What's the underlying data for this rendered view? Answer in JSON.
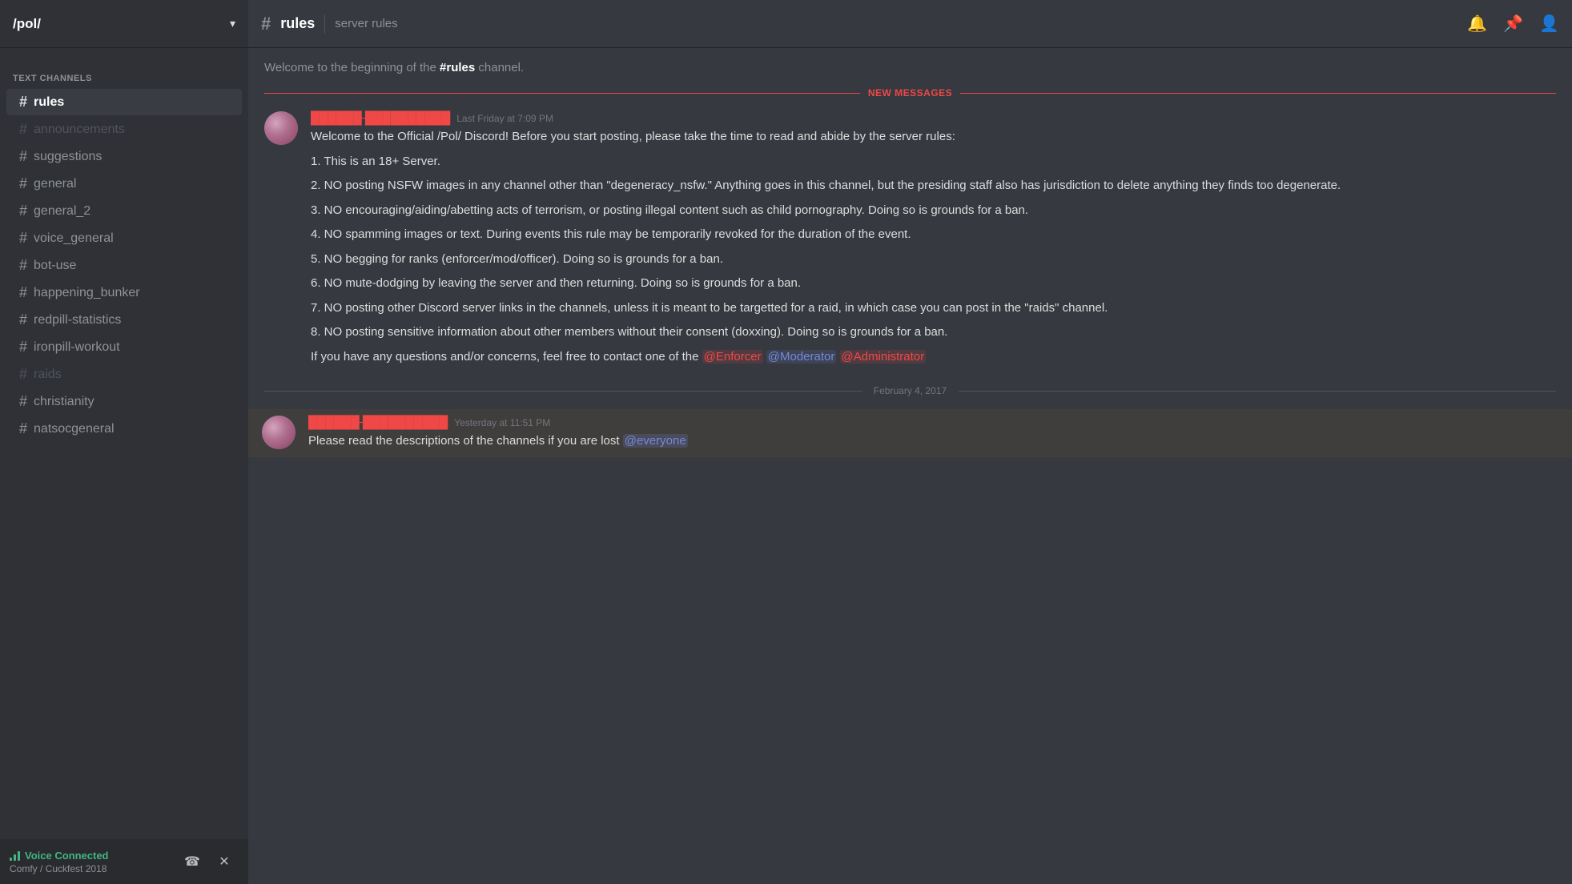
{
  "server": {
    "name": "/pol/",
    "chevron": "▾"
  },
  "sidebar": {
    "section_label": "TEXT CHANNELS",
    "channels": [
      {
        "id": "rules",
        "name": "rules",
        "active": true,
        "muted": false
      },
      {
        "id": "announcements",
        "name": "announcements",
        "active": false,
        "muted": true
      },
      {
        "id": "suggestions",
        "name": "suggestions",
        "active": false,
        "muted": false
      },
      {
        "id": "general",
        "name": "general",
        "active": false,
        "muted": false
      },
      {
        "id": "general_2",
        "name": "general_2",
        "active": false,
        "muted": false
      },
      {
        "id": "voice_general",
        "name": "voice_general",
        "active": false,
        "muted": false
      },
      {
        "id": "bot-use",
        "name": "bot-use",
        "active": false,
        "muted": false
      },
      {
        "id": "happening_bunker",
        "name": "happening_bunker",
        "active": false,
        "muted": false
      },
      {
        "id": "redpill-statistics",
        "name": "redpill-statistics",
        "active": false,
        "muted": false
      },
      {
        "id": "ironpill-workout",
        "name": "ironpill-workout",
        "active": false,
        "muted": false
      },
      {
        "id": "raids",
        "name": "raids",
        "active": false,
        "muted": true
      },
      {
        "id": "christianity",
        "name": "christianity",
        "active": false,
        "muted": false
      },
      {
        "id": "natsocgeneral",
        "name": "natsocgeneral",
        "active": false,
        "muted": false
      }
    ]
  },
  "voice": {
    "status": "Voice Connected",
    "channel": "Comfy / Cuckfest 2018"
  },
  "channel_header": {
    "hash": "#",
    "name": "rules",
    "topic": "server rules"
  },
  "messages": {
    "beginning_text": "Welcome to the beginning of the ",
    "beginning_channel": "#rules",
    "beginning_suffix": " channel.",
    "new_messages_label": "NEW MESSAGES",
    "message1": {
      "author": "██████ ██████████",
      "timestamp": "Last Friday at 7:09 PM",
      "lines": [
        "Welcome to the Official /Pol/ Discord! Before you start posting, please take the time to read and abide by the server rules:",
        "",
        "1. This is an 18+ Server.",
        "",
        "2. NO posting NSFW images in any channel other than \"degeneracy_nsfw.\" Anything goes in this channel, but the presiding staff also has jurisdiction to delete anything they finds too degenerate.",
        "",
        "3. NO encouraging/aiding/abetting acts of terrorism, or posting illegal content such as child pornography. Doing so is grounds for a ban.",
        "",
        "4. NO spamming images or text. During events this rule may be temporarily revoked for the duration of the event.",
        "",
        "5. NO begging for ranks (enforcer/mod/officer). Doing so is grounds for a ban.",
        "",
        "6. NO mute-dodging by leaving the server and then returning. Doing so is grounds for a ban.",
        "",
        "7. NO posting other Discord server links in the channels, unless it is meant to be targetted for a raid, in which case you can post in the \"raids\" channel.",
        "",
        "8. NO posting sensitive information about other members without their consent (doxxing). Doing so is grounds for a ban.",
        "",
        "If you have any questions and/or concerns, feel free to contact one of the "
      ],
      "mention_enforcer": "@Enforcer",
      "mention_moderator": "@Moderator",
      "mention_admin": "@Administrator"
    },
    "date_divider": "February 4, 2017",
    "message2": {
      "author": "██████ ██████████",
      "timestamp": "Yesterday at 11:51 PM",
      "text": "Please read the descriptions of the channels if you are lost ",
      "mention_everyone": "@everyone"
    }
  }
}
